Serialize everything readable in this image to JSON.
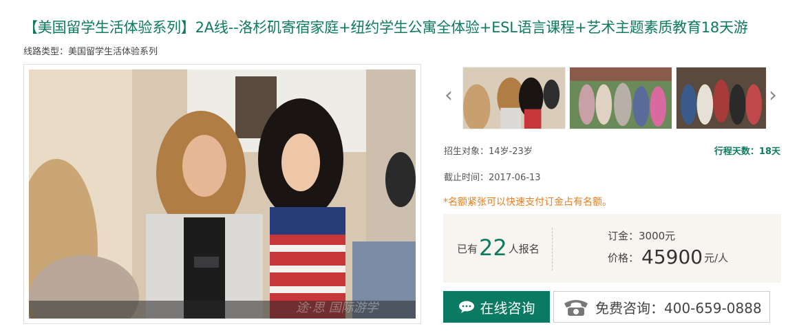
{
  "title": "【美国留学生活体验系列】2A线--洛杉矶寄宿家庭+纽约学生公寓全体验+ESL语言课程+艺术主题素质教育18天游",
  "route_type": "线路类型：美国留学生活体验系列",
  "main_photo": {
    "watermark": "途·思 国际游学"
  },
  "gallery": {
    "prev_icon": "chevron-left-icon",
    "next_icon": "chevron-right-icon"
  },
  "info": {
    "target": "招生对象：14岁-23岁",
    "days": "行程天数：18天",
    "deadline": "截止时间：2017-06-13",
    "urgent": "*名额紧张可以快速支付订金占有名额。"
  },
  "price_box": {
    "enrolled_prefix": "已有",
    "enrolled_count": "22",
    "enrolled_suffix": "人报名",
    "deposit": "订金：3000元",
    "price_label": "价格：",
    "price_value": "45900",
    "price_unit": "元/人"
  },
  "buttons": {
    "consult_label": "在线咨询",
    "consult_icon": "chat-bubble-icon",
    "hotline_icon": "phone-icon",
    "hotline_label": "免费咨询：400-659-0888"
  },
  "colors": {
    "brand_green": "#0e7a5e",
    "button_green": "#0b7a63",
    "warning_orange": "#e87e1c",
    "price_box_bg": "#f8f5f1"
  }
}
